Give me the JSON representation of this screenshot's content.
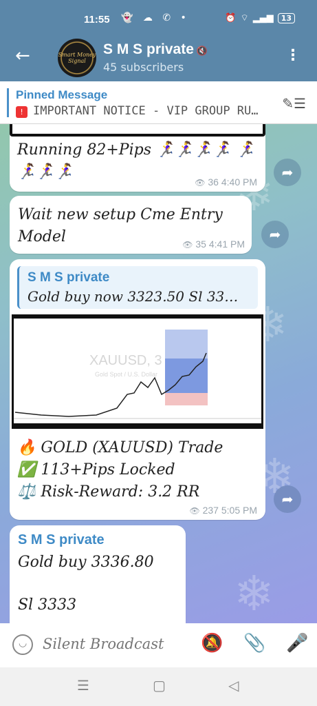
{
  "status_bar": {
    "time": "11:55",
    "icons": "👻 ☁ ✆ •",
    "battery": "13"
  },
  "header": {
    "back": "←",
    "avatar_text": "Smart Money Signal",
    "title": "S M S private",
    "mute_icon": "🔇",
    "subscribers": "45 subscribers",
    "menu": "⋮"
  },
  "pinned": {
    "title": "Pinned Message",
    "text": "IMPORTANT NOTICE - VIP GROUP RU…",
    "badge": "!"
  },
  "messages": [
    {
      "text": "Running 82+Pips 🏃‍♀️🏃‍♀️🏃‍♀️🏃‍♀️ 🏃‍♀️🏃‍♀️🏃‍♀️🏃‍♀️",
      "views": "36",
      "time": "4:40 PM"
    },
    {
      "text": "Wait new setup Cme Entry Model",
      "views": "35",
      "time": "4:41 PM"
    },
    {
      "reply_name": "S M S private",
      "reply_text": "Gold buy now 3323.50   Sl 33…",
      "chart_symbol": "XAUUSD, 3",
      "chart_sub": "Gold Spot / U.S. Dollar",
      "lines": [
        "🔥 GOLD (XAUUSD) Trade",
        "✅ 113+Pips Locked",
        "⚖️ Risk-Reward: 3.2 RR"
      ],
      "views": "237",
      "time": "5:05 PM"
    },
    {
      "name": "S M S private",
      "line1": "Gold buy 3336.80",
      "line2": "Sl 3333"
    }
  ],
  "input": {
    "placeholder": "Silent Broadcast"
  },
  "icons": {
    "back": "back-arrow-icon",
    "mute": "mute-icon",
    "menu": "more-vert-icon",
    "pin_list": "pin-list-icon",
    "share": "share-icon",
    "emoji": "emoji-icon",
    "bell": "bell-off-icon",
    "clip": "attach-icon",
    "mic": "mic-icon"
  },
  "colors": {
    "header": "#5b87a9",
    "accent": "#3e8ac6",
    "bubble": "#ffffff"
  }
}
